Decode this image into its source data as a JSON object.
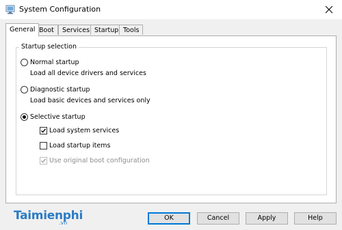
{
  "window": {
    "title": "System Configuration",
    "icons": {
      "app": "system-configuration-icon",
      "close": "close-icon"
    }
  },
  "tabs": [
    {
      "label": "General",
      "active": true
    },
    {
      "label": "Boot",
      "active": false
    },
    {
      "label": "Services",
      "active": false
    },
    {
      "label": "Startup",
      "active": false
    },
    {
      "label": "Tools",
      "active": false
    }
  ],
  "startup_selection": {
    "legend": "Startup selection",
    "normal": {
      "label": "Normal startup",
      "description": "Load all device drivers and services",
      "selected": false
    },
    "diagnostic": {
      "label": "Diagnostic startup",
      "description": "Load basic devices and services only",
      "selected": false
    },
    "selective": {
      "label": "Selective startup",
      "selected": true,
      "options": [
        {
          "label": "Load system services",
          "checked": true,
          "enabled": true
        },
        {
          "label": "Load startup items",
          "checked": false,
          "enabled": true
        },
        {
          "label": "Use original boot configuration",
          "checked": true,
          "enabled": false
        }
      ]
    }
  },
  "watermark": {
    "text": "Taimienphi",
    "suffix": ".vn"
  },
  "buttons": {
    "ok": "OK",
    "cancel": "Cancel",
    "apply": "Apply",
    "help": "Help"
  },
  "colors": {
    "accent": "#0078d7",
    "watermark": "#2a7cc6"
  }
}
